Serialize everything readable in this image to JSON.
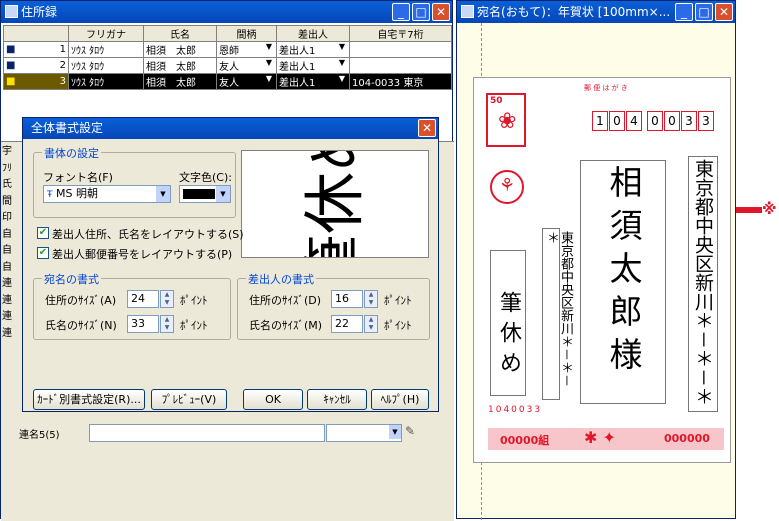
{
  "address_window": {
    "title": "住所録",
    "columns": [
      "フリガナ",
      "氏名",
      "間柄",
      "差出人",
      "自宅〒7桁"
    ],
    "rows": [
      {
        "num": "1",
        "kana": "ｿｳｽ ﾀﾛｳ",
        "name": "相須　太郎",
        "rel": "恩師",
        "sender": "差出人1",
        "zip": ""
      },
      {
        "num": "2",
        "kana": "ｿｳｽ ﾀﾛｳ",
        "name": "相須　太郎",
        "rel": "友人",
        "sender": "差出人1",
        "zip": ""
      },
      {
        "num": "3",
        "kana": "ｿｳｽ ﾀﾛｳ",
        "name": "相須　太郎",
        "rel": "友人",
        "sender": "差出人1",
        "zip": "104-0033",
        "extra": "東京"
      }
    ],
    "side_labels": [
      "宇",
      "ﾌﾘ",
      "氏",
      "間",
      "印",
      "",
      "自",
      "自",
      "自",
      "連",
      "連",
      "連",
      "連"
    ],
    "bottom_label": "連名5(5)"
  },
  "dialog": {
    "title": "全体書式設定",
    "font_group": "書体の設定",
    "font_label": "フォント名(F)",
    "font_value": "MS 明朝",
    "color_label": "文字色(C):",
    "preview_text": "筆休め",
    "check1": "差出人住所、氏名をレイアウトする(S)",
    "check2": "差出人郵便番号をレイアウトする(P)",
    "dest_group": "宛名の書式",
    "sender_group": "差出人の書式",
    "addr_size_label": "住所のｻｲｽﾞ(A)",
    "name_size_label": "氏名のｻｲｽﾞ(N)",
    "s_addr_size_label": "住所のｻｲｽﾞ(D)",
    "s_name_size_label": "氏名のｻｲｽﾞ(M)",
    "addr_size": "24",
    "name_size": "33",
    "s_addr_size": "16",
    "s_name_size": "22",
    "unit": "ﾎﾟｲﾝﾄ",
    "btn_card": "ｶｰﾄﾞ別書式設定(R)...",
    "btn_preview": "ﾌﾟﾚﾋﾞｭｰ(V)",
    "btn_ok": "OK",
    "btn_cancel": "ｷｬﾝｾﾙ",
    "btn_help": "ﾍﾙﾌﾟ(H)"
  },
  "preview_window": {
    "title": "宛名(おもて)：年賀状 [100mm×...",
    "postcard_label": "郵 便 は が き",
    "zip_digits": [
      "1",
      "0",
      "4",
      "0",
      "0",
      "3",
      "3"
    ],
    "address": "東京都中央区新川＊－＊－＊",
    "name": "相須太郎様",
    "sender_address": "東京都中央区新川＊－＊－＊",
    "sender_name": "筆休め",
    "sender_zip": "1040033",
    "stamp_value": "50",
    "lottery_left": "00000組",
    "lottery_right": "000000"
  },
  "annotation": {
    "mark": "※"
  }
}
